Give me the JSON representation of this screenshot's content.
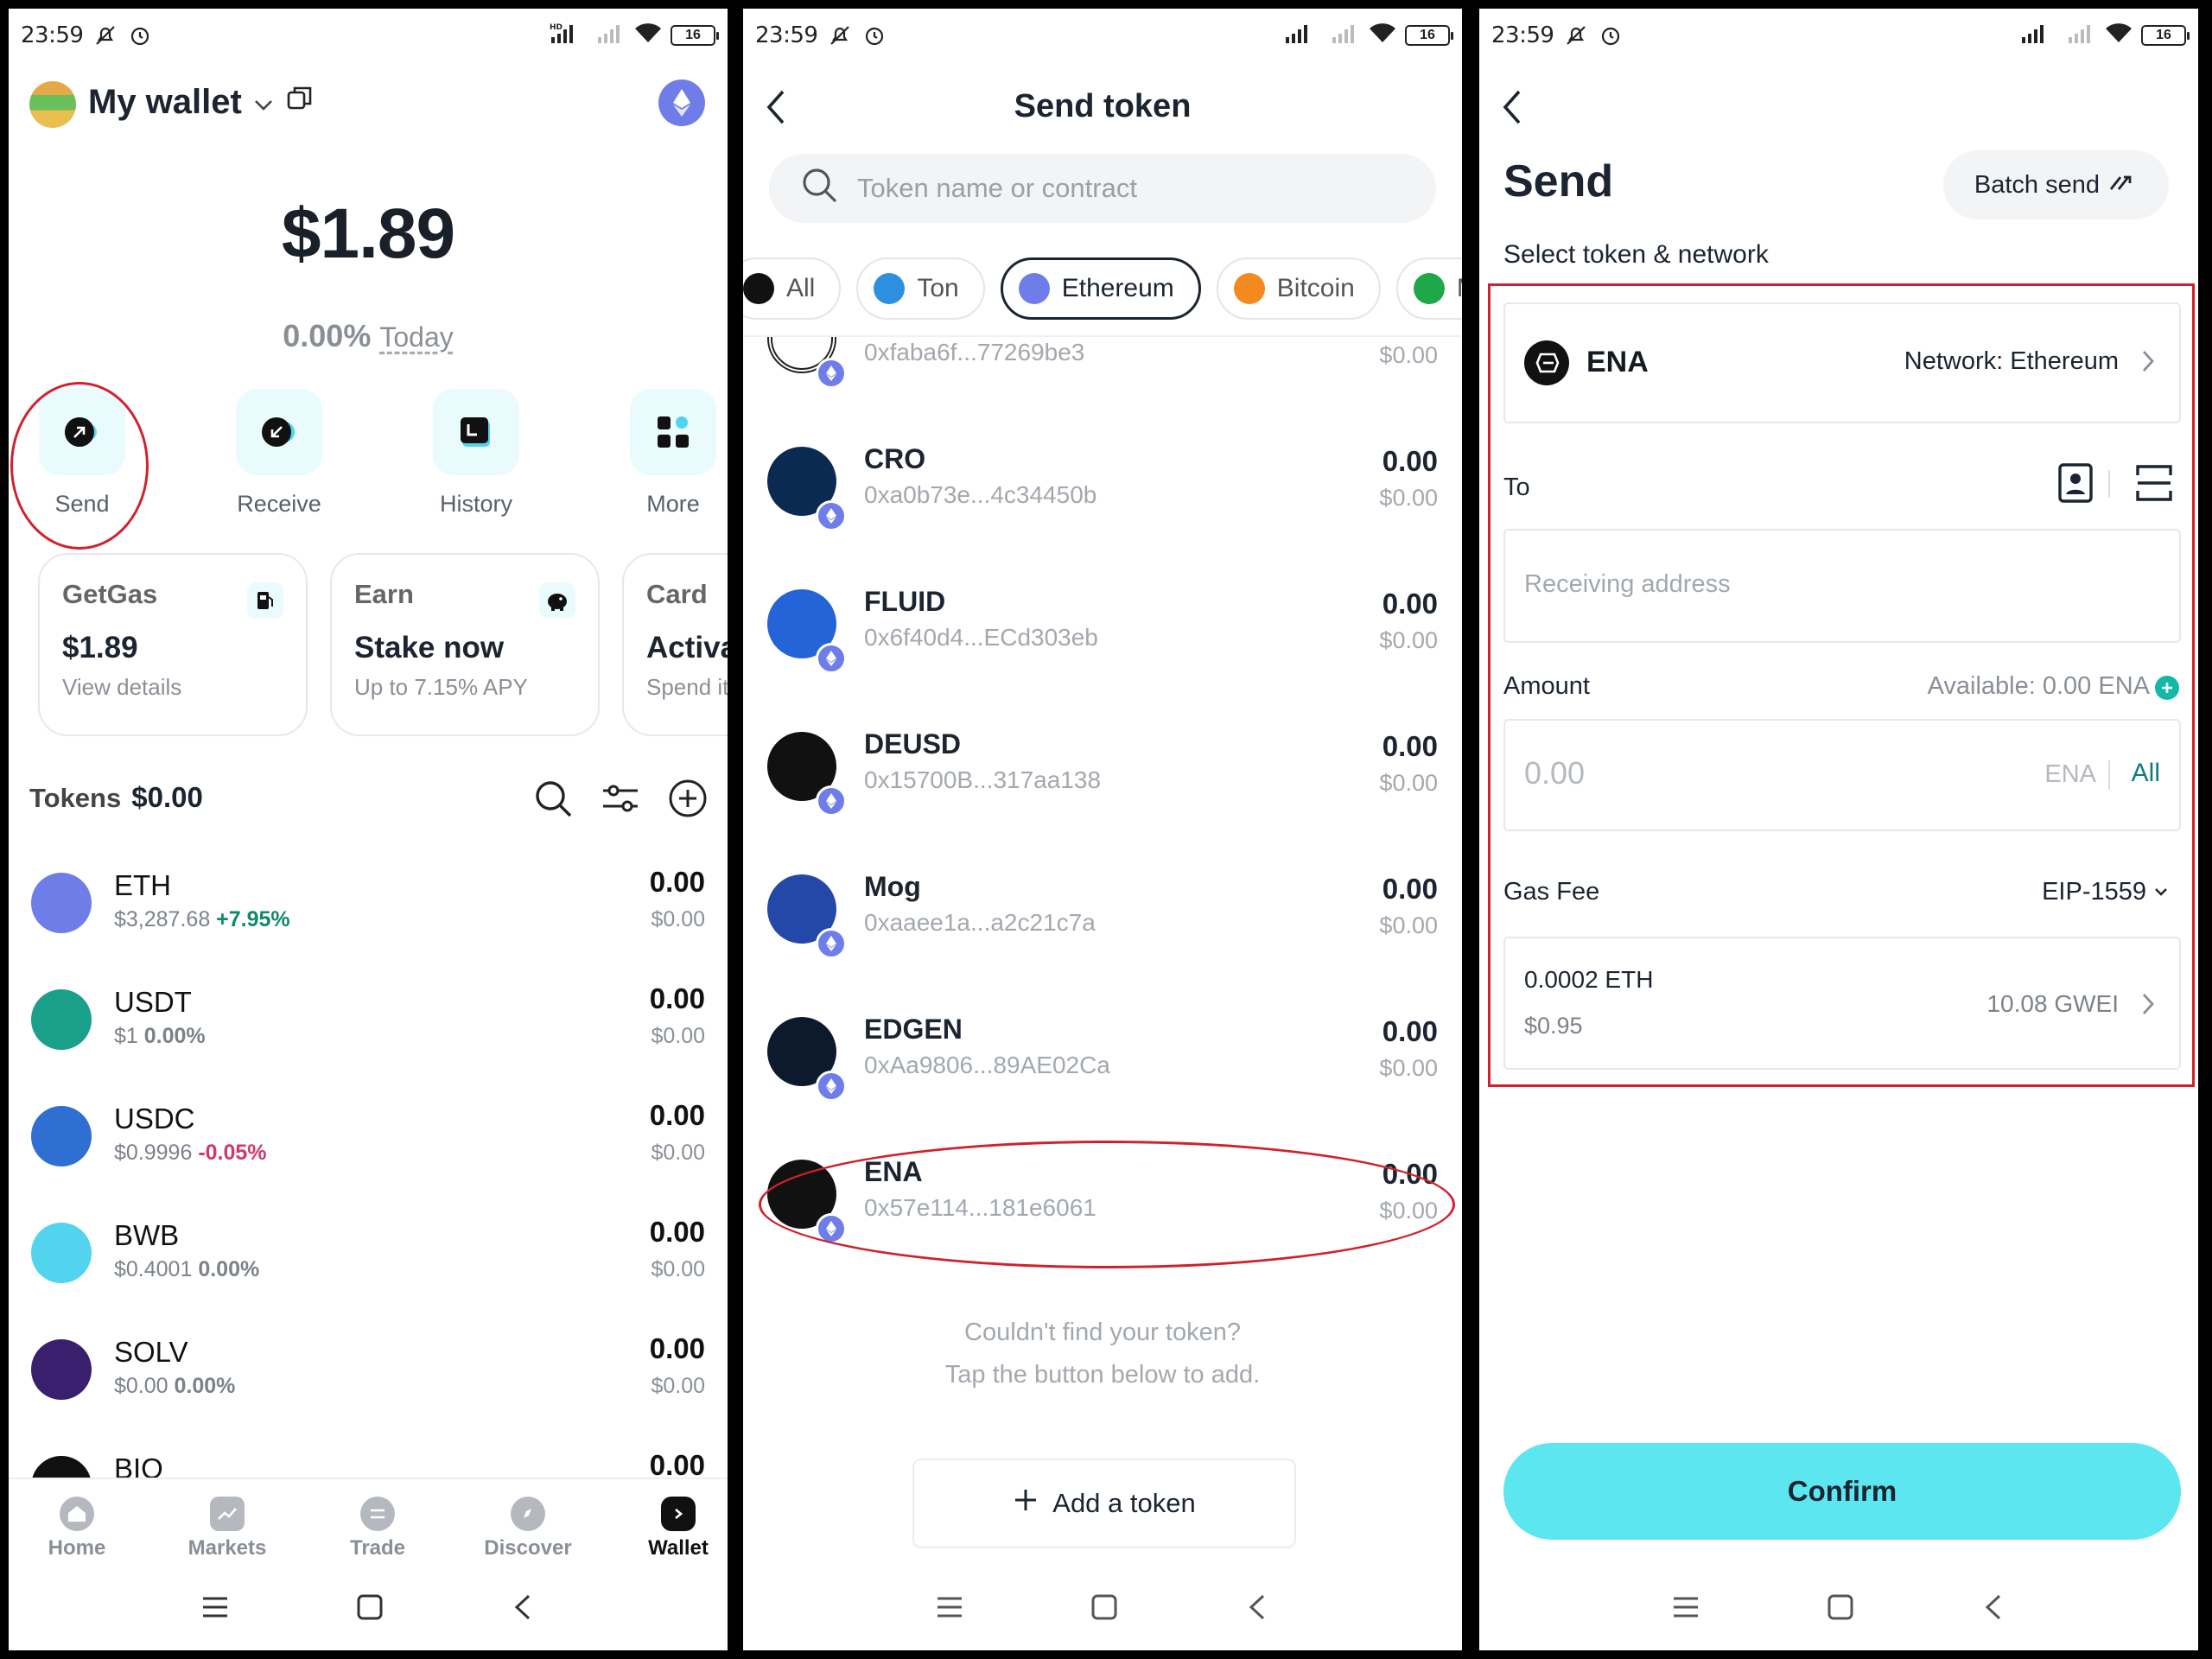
{
  "status": {
    "time": "23:59",
    "battery": "16",
    "hd": "HD"
  },
  "wallet": {
    "title": "My wallet",
    "balance": "$1.89",
    "change": "0.00%",
    "change_period": "Today",
    "actions": [
      {
        "label": "Send"
      },
      {
        "label": "Receive"
      },
      {
        "label": "History"
      },
      {
        "label": "More"
      }
    ],
    "cards": [
      {
        "title": "GetGas",
        "value": "$1.89",
        "sub": "View details"
      },
      {
        "title": "Earn",
        "value": "Stake now",
        "sub": "Up to 7.15% APY"
      },
      {
        "title": "Card",
        "value": "Activa",
        "sub": "Spend it"
      }
    ],
    "tokens_label": "Tokens",
    "tokens_total": "$0.00",
    "tokens": [
      {
        "symbol": "ETH",
        "price": "$3,287.68",
        "change": "+7.95%",
        "amount": "0.00",
        "usd": "$0.00",
        "color": "#6f7de8",
        "trend": "pos"
      },
      {
        "symbol": "USDT",
        "price": "$1",
        "change": "0.00%",
        "amount": "0.00",
        "usd": "$0.00",
        "color": "#1aa08a",
        "trend": "flat"
      },
      {
        "symbol": "USDC",
        "price": "$0.9996",
        "change": "-0.05%",
        "amount": "0.00",
        "usd": "$0.00",
        "color": "#2f6fd1",
        "trend": "neg"
      },
      {
        "symbol": "BWB",
        "price": "$0.4001",
        "change": "0.00%",
        "amount": "0.00",
        "usd": "$0.00",
        "color": "#52d3ee",
        "trend": "flat"
      },
      {
        "symbol": "SOLV",
        "price": "$0.00",
        "change": "0.00%",
        "amount": "0.00",
        "usd": "$0.00",
        "color": "#3a1f6e",
        "trend": "flat"
      },
      {
        "symbol": "BIO",
        "price": "",
        "change": "",
        "amount": "0.00",
        "usd": "",
        "color": "#111111",
        "trend": "flat"
      }
    ],
    "bottom_nav": [
      {
        "label": "Home"
      },
      {
        "label": "Markets"
      },
      {
        "label": "Trade"
      },
      {
        "label": "Discover"
      },
      {
        "label": "Wallet"
      }
    ]
  },
  "send_token": {
    "title": "Send token",
    "search_placeholder": "Token name or contract",
    "chips": [
      {
        "label": "All",
        "color": "#111111"
      },
      {
        "label": "Ton",
        "color": "#2d8fe0"
      },
      {
        "label": "Ethereum",
        "color": "#6f7de8"
      },
      {
        "label": "Bitcoin",
        "color": "#f28a1e"
      },
      {
        "label": "M",
        "color": "#1fa84a"
      }
    ],
    "tokens": [
      {
        "name": "",
        "address": "0xfaba6f...77269be3",
        "amount": "",
        "usd": "$0.00",
        "color": "#ffffff"
      },
      {
        "name": "CRO",
        "address": "0xa0b73e...4c34450b",
        "amount": "0.00",
        "usd": "$0.00",
        "color": "#0b2a52"
      },
      {
        "name": "FLUID",
        "address": "0x6f40d4...ECd303eb",
        "amount": "0.00",
        "usd": "$0.00",
        "color": "#2563d9"
      },
      {
        "name": "DEUSD",
        "address": "0x15700B...317aa138",
        "amount": "0.00",
        "usd": "$0.00",
        "color": "#111111"
      },
      {
        "name": "Mog",
        "address": "0xaaee1a...a2c21c7a",
        "amount": "0.00",
        "usd": "$0.00",
        "color": "#2448a8"
      },
      {
        "name": "EDGEN",
        "address": "0xAa9806...89AE02Ca",
        "amount": "0.00",
        "usd": "$0.00",
        "color": "#0d1a2e"
      },
      {
        "name": "ENA",
        "address": "0x57e114...181e6061",
        "amount": "0.00",
        "usd": "$0.00",
        "color": "#111111"
      }
    ],
    "not_found_line1": "Couldn't find your token?",
    "not_found_line2": "Tap the button below to add.",
    "add_label": "Add a token"
  },
  "send": {
    "title": "Send",
    "batch_label": "Batch send",
    "select_label": "Select token & network",
    "token": "ENA",
    "network": "Network: Ethereum",
    "to_label": "To",
    "address_placeholder": "Receiving address",
    "amount_label": "Amount",
    "available": "Available: 0.00 ENA",
    "amount_placeholder": "0.00",
    "amount_unit": "ENA",
    "all_label": "All",
    "gas_label": "Gas Fee",
    "gas_mode": "EIP-1559",
    "gas_value": "0.0002 ETH",
    "gas_usd": "$0.95",
    "gas_gwei": "10.08 GWEI",
    "confirm_label": "Confirm"
  }
}
